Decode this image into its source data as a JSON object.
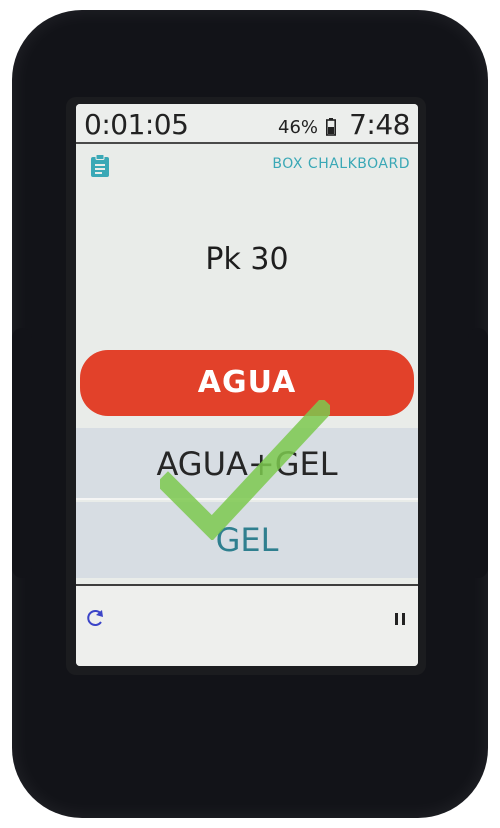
{
  "status_bar": {
    "elapsed_time": "0:01:05",
    "battery_percent": "46%",
    "clock": "7:48"
  },
  "header": {
    "app_name": "BOX CHALKBOARD",
    "icon": "clipboard-icon"
  },
  "main": {
    "title": "Pk 30",
    "options": [
      {
        "label": "AGUA",
        "color": "#e2412a",
        "selected": true
      },
      {
        "label": "AGUA+GEL",
        "color": "#262626"
      },
      {
        "label": "GEL",
        "color": "#2f7f8f"
      }
    ],
    "check_mark_color": "#7cc94f"
  },
  "footer": {
    "left_icon": "reset-icon",
    "right_icon": "pause-icon"
  },
  "colors": {
    "accent": "#3aa8b6",
    "device_body": "#121318",
    "screen_bg": "#e9ece9"
  }
}
